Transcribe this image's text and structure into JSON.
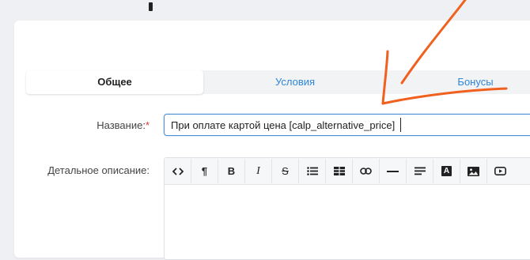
{
  "tabs": [
    {
      "label": "Общее",
      "active": true
    },
    {
      "label": "Условия",
      "active": false
    },
    {
      "label": "Бонусы",
      "active": false
    }
  ],
  "form": {
    "name_label": "Название:",
    "required_mark": "*",
    "name_value": "При оплате картой цена [calp_alternative_price]",
    "description_label": "Детальное описание:"
  },
  "editor_toolbar": [
    {
      "icon": "code-icon",
      "glyph": "<>"
    },
    {
      "icon": "paragraph-icon",
      "glyph": "¶"
    },
    {
      "icon": "bold-icon",
      "glyph": "B"
    },
    {
      "icon": "italic-icon",
      "glyph": "I"
    },
    {
      "icon": "strikethrough-icon",
      "glyph": "S"
    },
    {
      "icon": "bulleted-list-icon",
      "glyph": ""
    },
    {
      "icon": "table-icon",
      "glyph": ""
    },
    {
      "icon": "link-icon",
      "glyph": ""
    },
    {
      "icon": "horizontal-rule-icon",
      "glyph": ""
    },
    {
      "icon": "align-icon",
      "glyph": ""
    },
    {
      "icon": "font-color-icon",
      "glyph": "A"
    },
    {
      "icon": "image-icon",
      "glyph": ""
    },
    {
      "icon": "video-icon",
      "glyph": ""
    }
  ],
  "colors": {
    "accent": "#2f86d6",
    "arrow": "#f0601e",
    "required": "#e23a3a"
  }
}
